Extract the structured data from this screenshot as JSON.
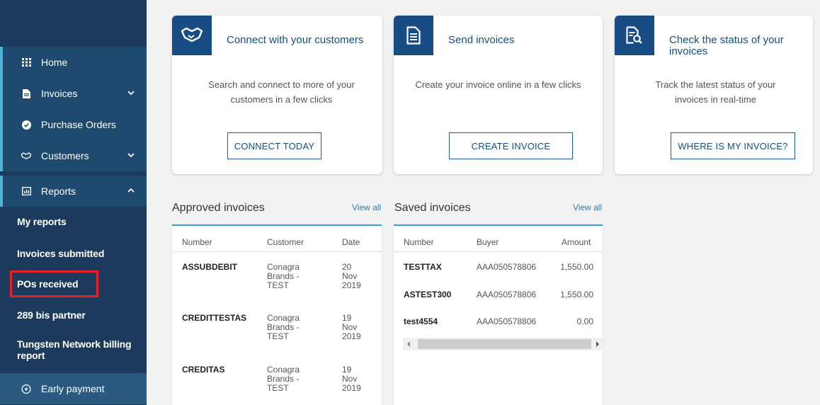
{
  "sidebar": {
    "items": [
      {
        "label": "Home",
        "icon": "grid-icon"
      },
      {
        "label": "Invoices",
        "icon": "document-icon",
        "chevron": "down"
      },
      {
        "label": "Purchase Orders",
        "icon": "check-circle-icon"
      },
      {
        "label": "Customers",
        "icon": "handshake-icon",
        "chevron": "down"
      },
      {
        "label": "Reports",
        "icon": "report-icon",
        "chevron": "up"
      }
    ],
    "sub_items": [
      "My reports",
      "Invoices submitted",
      "POs received",
      "289 bis partner",
      "Tungsten Network billing report"
    ],
    "bottom_item": {
      "label": "Early payment",
      "icon": "coins-icon"
    },
    "highlighted": "POs received"
  },
  "cards": [
    {
      "title": "Connect with your customers",
      "description": "Search and connect to more of your customers in a few clicks",
      "button": "CONNECT TODAY",
      "icon": "handshake-icon"
    },
    {
      "title": "Send invoices",
      "description": "Create your invoice online in a few clicks",
      "button": "CREATE INVOICE",
      "icon": "document-icon"
    },
    {
      "title": "Check the status of your invoices",
      "description": "Track the latest status of your invoices in real-time",
      "button": "WHERE IS MY INVOICE?",
      "icon": "document-search-icon"
    }
  ],
  "approved": {
    "title": "Approved invoices",
    "view_all": "View all",
    "columns": [
      "Number",
      "Customer",
      "Date"
    ],
    "rows": [
      {
        "number": "ASSUBDEBIT",
        "customer": "Conagra Brands - TEST",
        "date": "20 Nov 2019"
      },
      {
        "number": "CREDITTESTAS",
        "customer": "Conagra Brands - TEST",
        "date": "19 Nov 2019"
      },
      {
        "number": "CREDITAS",
        "customer": "Conagra Brands - TEST",
        "date": "19 Nov 2019"
      }
    ]
  },
  "saved": {
    "title": "Saved invoices",
    "view_all": "View all",
    "columns": [
      "Number",
      "Buyer",
      "Amount"
    ],
    "rows": [
      {
        "number": "TESTTAX",
        "buyer": "AAA050578806",
        "amount": "1,550.00"
      },
      {
        "number": "ASTEST300",
        "buyer": "AAA050578806",
        "amount": "1,550.00"
      },
      {
        "number": "test4554",
        "buyer": "AAA050578806",
        "amount": "0.00"
      }
    ]
  },
  "colors": {
    "sidebar_bg": "#1b3a5c",
    "accent": "#174c84",
    "highlight": "#e8202a",
    "panel_border": "#3aa3c9"
  }
}
